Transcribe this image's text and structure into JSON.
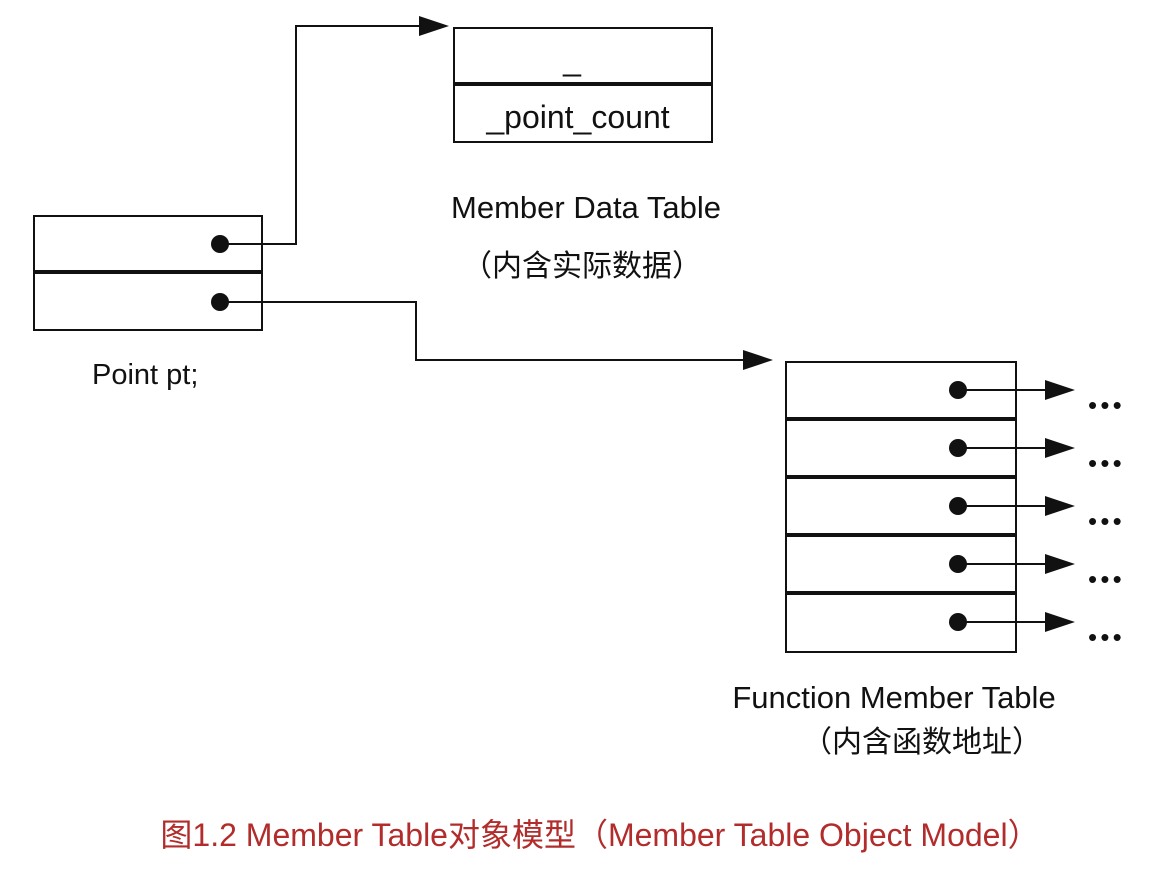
{
  "point_object": {
    "label": "Point pt;"
  },
  "member_data_table": {
    "rows": [
      "_",
      "_point_count"
    ],
    "title": "Member Data Table",
    "subtitle": "（内含实际数据）"
  },
  "function_member_table": {
    "row_count": 5,
    "ellipsis": "• • •",
    "title": "Function Member Table",
    "subtitle": "（内含函数地址）"
  },
  "caption": {
    "text": "图1.2 Member Table对象模型（Member Table Object Model）"
  },
  "colors": {
    "line": "#111111",
    "caption": "#b22c2c"
  }
}
